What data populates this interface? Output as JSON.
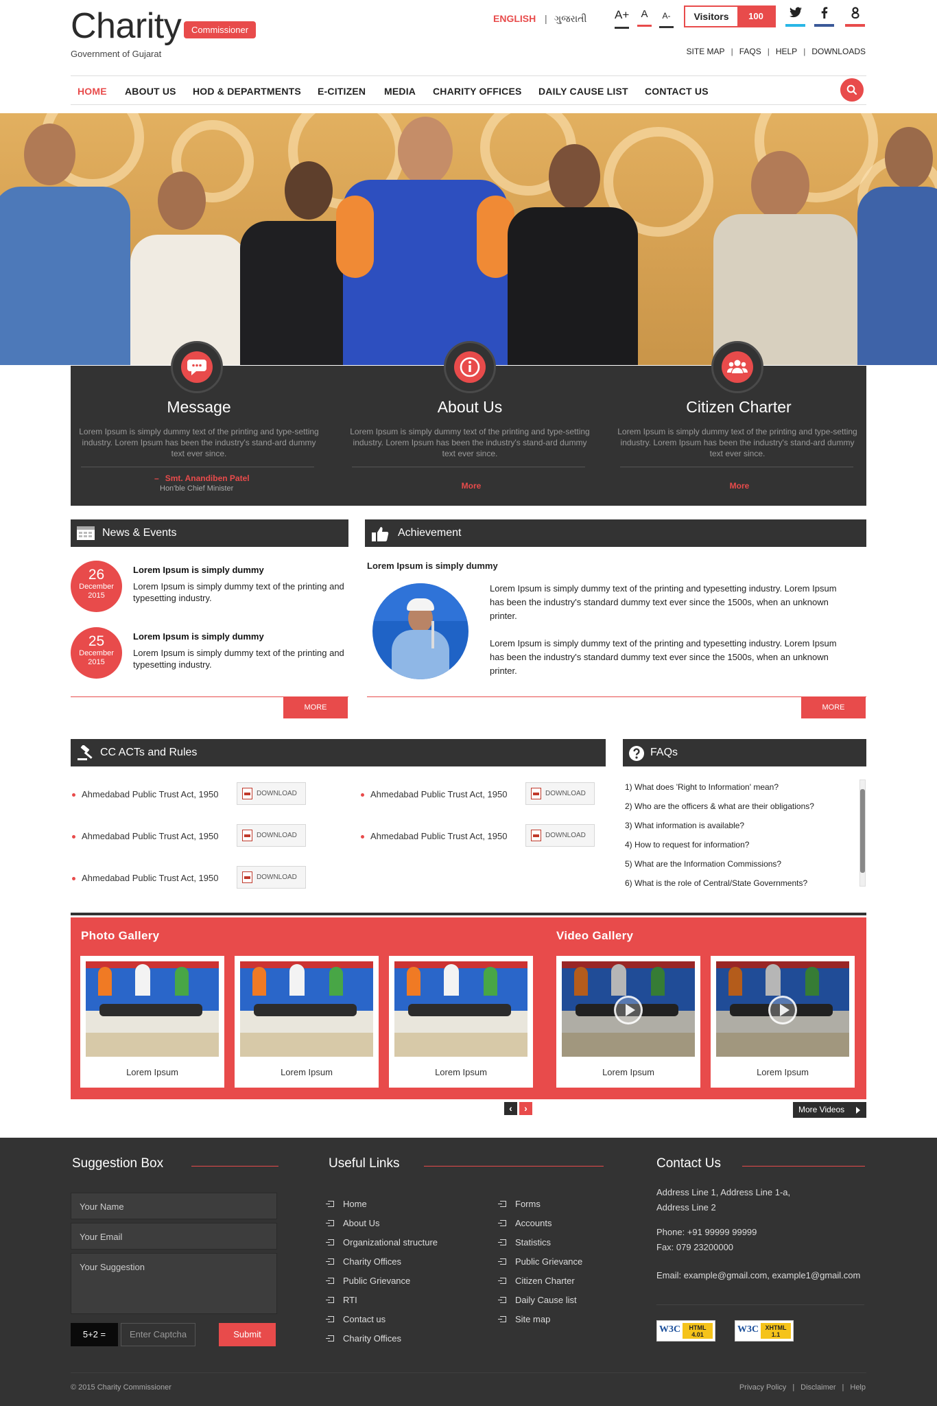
{
  "header": {
    "logo_title": "Charity",
    "logo_badge": "Commissioner",
    "logo_sub": "Government of Gujarat",
    "lang_en": "ENGLISH",
    "lang_sep": "|",
    "lang_gu": "ગુજરાતી",
    "font_large": "A+",
    "font_normal": "A",
    "font_small": "A-",
    "visitors_label": "Visitors",
    "visitors_count": "100",
    "social": {
      "twitter": "twitter-icon",
      "facebook": "facebook-icon",
      "google": "google-plus-icon"
    },
    "top_links": [
      "SITE MAP",
      "FAQS",
      "HELP",
      "DOWNLOADS"
    ],
    "top_links_sep": "|"
  },
  "nav": {
    "items": [
      "HOME",
      "ABOUT US",
      "HOD & DEPARTMENTS",
      "E-CITIZEN",
      "MEDIA",
      "CHARITY OFFICES",
      "DAILY CAUSE LIST",
      "CONTACT US"
    ],
    "active_index": 0,
    "search_icon": "search-icon"
  },
  "info": {
    "message": {
      "title": "Message",
      "text": "Lorem Ipsum is simply dummy text of the printing and type-setting industry. Lorem Ipsum has been the industry's stand-ard dummy text ever since.",
      "name_dash": "–",
      "name": "Smt. Anandiben Patel",
      "role": "Hon'ble Chief Minister"
    },
    "about": {
      "title": "About Us",
      "text": "Lorem Ipsum is simply dummy text of the printing and type-setting industry. Lorem Ipsum has been the industry's stand-ard dummy text ever since.",
      "more": "More"
    },
    "charter": {
      "title": "Citizen Charter",
      "text": "Lorem Ipsum is simply dummy text of the printing and type-setting industry. Lorem Ipsum has been the industry's stand-ard dummy text ever since.",
      "more": "More"
    }
  },
  "news": {
    "title": "News & Events",
    "items": [
      {
        "day": "26",
        "month": "December",
        "year": "2015",
        "heading": "Lorem Ipsum is simply dummy",
        "text": "Lorem Ipsum is simply dummy text of the printing and typesetting industry."
      },
      {
        "day": "25",
        "month": "December",
        "year": "2015",
        "heading": "Lorem Ipsum is simply dummy",
        "text": "Lorem Ipsum is simply dummy text of the printing and typesetting industry."
      }
    ],
    "more": "MORE"
  },
  "achievement": {
    "title": "Achievement",
    "heading": "Lorem Ipsum is simply dummy",
    "para1": "Lorem Ipsum is simply dummy text of the printing and typesetting industry. Lorem Ipsum has been the industry's standard dummy text ever since the 1500s, when an unknown printer.",
    "para2": "Lorem Ipsum is simply dummy text of the printing and typesetting industry. Lorem Ipsum has been the industry's standard dummy text ever since the 1500s, when an unknown printer.",
    "more": "MORE"
  },
  "acts": {
    "title": "CC ACTs and Rules",
    "items": [
      "Ahmedabad Public Trust Act, 1950",
      "Ahmedabad Public Trust Act, 1950",
      "Ahmedabad Public Trust Act, 1950",
      "Ahmedabad Public Trust Act, 1950",
      "Ahmedabad Public Trust Act, 1950"
    ],
    "download": "DOWNLOAD"
  },
  "faqs": {
    "title": "FAQs",
    "items": [
      "1) What does 'Right to Information' mean?",
      "2) Who are the officers & what are their obligations?",
      "3) What information is available?",
      "4) How to request for information?",
      "5) What are the Information Commissions?",
      "6) What is the role of Central/State Governments?"
    ]
  },
  "gallery": {
    "photo_title": "Photo Gallery",
    "video_title": "Video Gallery",
    "photos": [
      "Lorem Ipsum",
      "Lorem Ipsum",
      "Lorem Ipsum"
    ],
    "videos": [
      "Lorem Ipsum",
      "Lorem Ipsum"
    ],
    "prev": "‹",
    "next": "›",
    "more_videos": "More Videos"
  },
  "footer": {
    "suggestion": {
      "title": "Suggestion Box",
      "name_placeholder": "Your Name",
      "email_placeholder": "Your Email",
      "suggestion_placeholder": "Your Suggestion",
      "captcha": "5+2 =",
      "captcha_placeholder": "Enter Captcha",
      "submit": "Submit"
    },
    "links": {
      "title": "Useful Links",
      "col1": [
        "Home",
        "About Us",
        "Organizational structure",
        "Charity Offices",
        "Public Grievance",
        "RTI",
        "Contact us",
        "Charity Offices"
      ],
      "col2": [
        "Forms",
        "Accounts",
        "Statistics",
        "Public Grievance",
        "Citizen Charter",
        "Daily Cause list",
        "Site map"
      ]
    },
    "contact": {
      "title": "Contact Us",
      "address1": "Address Line 1, Address Line 1-a,",
      "address2": "Address Line 2",
      "phone": "Phone: +91 99999 99999",
      "fax": "Fax: 079 23200000",
      "email": "Email: example@gmail.com, example1@gmail.com",
      "badge_html": "HTML 4.01",
      "badge_xhtml": "XHTML 1.1",
      "w3c": "W3C"
    },
    "copyright": "© 2015 Charity Commissioner",
    "bottom_links": [
      "Privacy Policy",
      "Disclaimer",
      "Help"
    ],
    "bottom_sep": "|"
  },
  "colors": {
    "accent": "#e84b4b",
    "dark": "#333333"
  }
}
